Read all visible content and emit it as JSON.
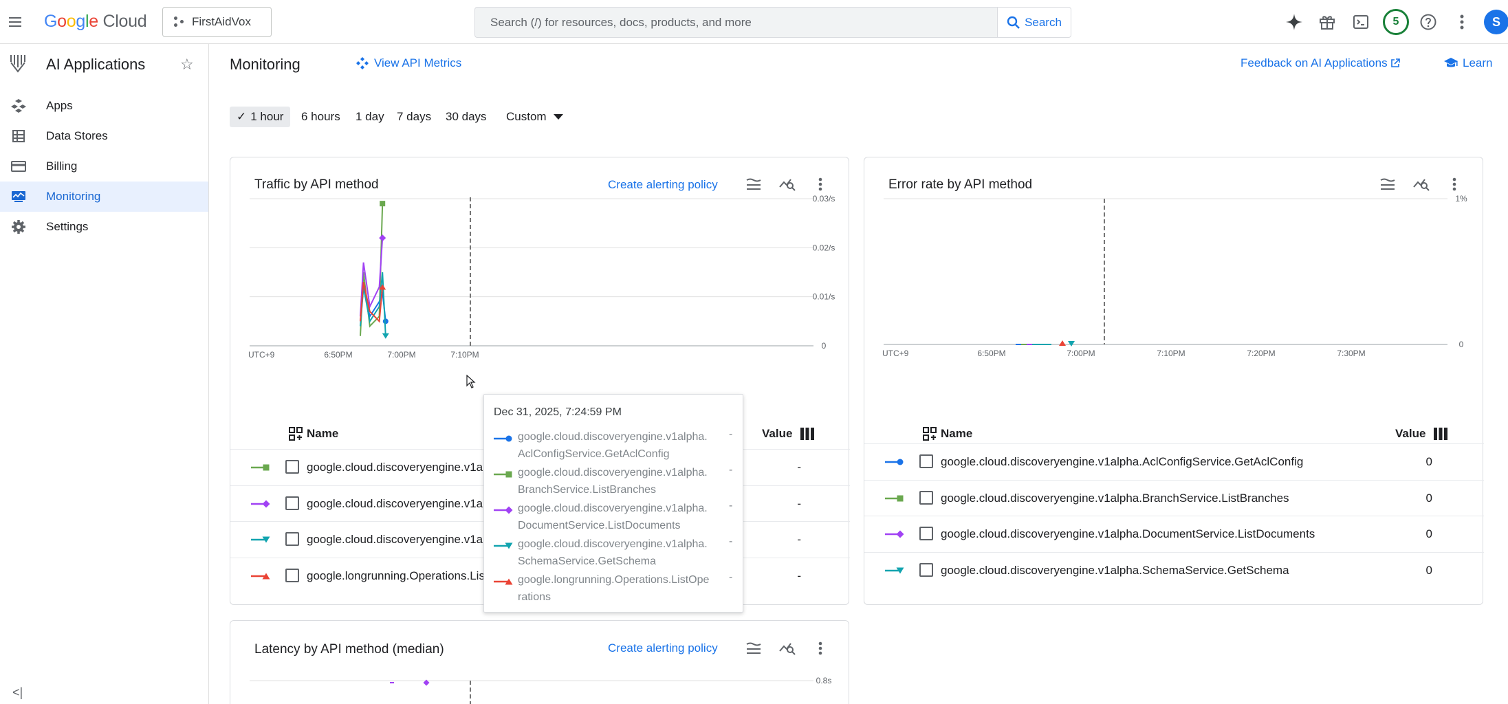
{
  "header": {
    "logo_google": "Google",
    "logo_cloud": "Cloud",
    "project_name": "FirstAidVox",
    "search_placeholder": "Search (/) for resources, docs, products, and more",
    "search_button": "Search",
    "notification_count": "5",
    "avatar_initial": "S"
  },
  "sidebar": {
    "product_title": "AI Applications",
    "items": [
      {
        "label": "Apps",
        "icon": "apps-icon"
      },
      {
        "label": "Data Stores",
        "icon": "data-stores-icon"
      },
      {
        "label": "Billing",
        "icon": "billing-icon"
      },
      {
        "label": "Monitoring",
        "icon": "monitoring-icon",
        "active": true
      },
      {
        "label": "Settings",
        "icon": "settings-icon"
      }
    ],
    "collapse_label": "<|"
  },
  "page": {
    "title": "Monitoring",
    "view_api_metrics": "View API Metrics",
    "feedback_link": "Feedback on AI Applications",
    "learn_link": "Learn"
  },
  "time_ranges": [
    {
      "label": "1 hour",
      "active": true
    },
    {
      "label": "6 hours"
    },
    {
      "label": "1 day"
    },
    {
      "label": "7 days"
    },
    {
      "label": "30 days"
    },
    {
      "label": "Custom",
      "dropdown": true
    }
  ],
  "colors": {
    "blue": "#1a73e8",
    "green": "#6aa84f",
    "purple": "#a142f4",
    "teal": "#12a4af",
    "red": "#ea4335"
  },
  "traffic_card": {
    "title": "Traffic by API method",
    "create_alert": "Create alerting policy",
    "name_header": "Name",
    "value_header": "Value",
    "rows": [
      {
        "name": "google.cloud.discoveryengine.v1alpha.BranchService.ListBranches",
        "value": "-",
        "marker": "square",
        "color": "#6aa84f"
      },
      {
        "name": "google.cloud.discoveryengine.v1alpha.DocumentService.ListDocuments",
        "value": "-",
        "marker": "diamond",
        "color": "#a142f4"
      },
      {
        "name": "google.cloud.discoveryengine.v1alpha.SchemaService.GetSchema",
        "value": "-",
        "marker": "triangle-down",
        "color": "#12a4af"
      },
      {
        "name": "google.longrunning.Operations.ListOperations",
        "value": "-",
        "marker": "triangle-up",
        "color": "#ea4335"
      }
    ]
  },
  "error_card": {
    "title": "Error rate by API method",
    "name_header": "Name",
    "value_header": "Value",
    "rows": [
      {
        "name": "google.cloud.discoveryengine.v1alpha.AclConfigService.GetAclConfig",
        "value": "0",
        "marker": "circle",
        "color": "#1a73e8"
      },
      {
        "name": "google.cloud.discoveryengine.v1alpha.BranchService.ListBranches",
        "value": "0",
        "marker": "square",
        "color": "#6aa84f"
      },
      {
        "name": "google.cloud.discoveryengine.v1alpha.DocumentService.ListDocuments",
        "value": "0",
        "marker": "diamond",
        "color": "#a142f4"
      },
      {
        "name": "google.cloud.discoveryengine.v1alpha.SchemaService.GetSchema",
        "value": "0",
        "marker": "triangle-down",
        "color": "#12a4af"
      }
    ]
  },
  "latency_card": {
    "title": "Latency by API method (median)",
    "create_alert": "Create alerting policy"
  },
  "tooltip": {
    "time": "Dec 31, 2025, 7:24:59 PM",
    "rows": [
      {
        "line1": "google.cloud.discoveryengine.v1alpha.",
        "line2": "AclConfigService.GetAclConfig",
        "value": "-",
        "marker": "circle",
        "color": "#1a73e8"
      },
      {
        "line1": "google.cloud.discoveryengine.v1alpha.",
        "line2": "BranchService.ListBranches",
        "value": "-",
        "marker": "square",
        "color": "#6aa84f"
      },
      {
        "line1": "google.cloud.discoveryengine.v1alpha.",
        "line2": "DocumentService.ListDocuments",
        "value": "-",
        "marker": "diamond",
        "color": "#a142f4"
      },
      {
        "line1": "google.cloud.discoveryengine.v1alpha.",
        "line2": "SchemaService.GetSchema",
        "value": "-",
        "marker": "triangle-down",
        "color": "#12a4af"
      },
      {
        "line1": "google.longrunning.Operations.ListOpe",
        "line2": "rations",
        "value": "-",
        "marker": "triangle-up",
        "color": "#ea4335"
      }
    ]
  },
  "chart_data": [
    {
      "type": "line",
      "title": "Traffic by API method",
      "timezone_label": "UTC+9",
      "x_ticks": [
        "6:50PM",
        "7:00PM",
        "7:10PM"
      ],
      "y_ticks": [
        "0",
        "0.01/s",
        "0.02/s",
        "0.03/s"
      ],
      "ylim": [
        0,
        0.03
      ],
      "hover_time": "7:24:59 PM",
      "series": [
        {
          "name": "google.cloud.discoveryengine.v1alpha.AclConfigService.GetAclConfig",
          "color": "#1a73e8",
          "marker": "circle",
          "points": [
            [
              "6:55",
              0.005
            ],
            [
              "6:55:30",
              0.012
            ],
            [
              "6:56:30",
              0.006
            ],
            [
              "6:58",
              0.009
            ],
            [
              "6:58:30",
              0.011
            ],
            [
              "6:59",
              0.005
            ]
          ]
        },
        {
          "name": "google.cloud.discoveryengine.v1alpha.BranchService.ListBranches",
          "color": "#6aa84f",
          "marker": "square",
          "points": [
            [
              "6:55",
              0.002
            ],
            [
              "6:55:30",
              0.015
            ],
            [
              "6:56:30",
              0.004
            ],
            [
              "6:58",
              0.006
            ],
            [
              "6:58:30",
              0.029
            ]
          ]
        },
        {
          "name": "google.cloud.discoveryengine.v1alpha.DocumentService.ListDocuments",
          "color": "#a142f4",
          "marker": "diamond",
          "points": [
            [
              "6:55",
              0.006
            ],
            [
              "6:55:30",
              0.017
            ],
            [
              "6:56:30",
              0.008
            ],
            [
              "6:58",
              0.012
            ],
            [
              "6:58:30",
              0.022
            ]
          ]
        },
        {
          "name": "google.cloud.discoveryengine.v1alpha.SchemaService.GetSchema",
          "color": "#12a4af",
          "marker": "triangle-down",
          "points": [
            [
              "6:55",
              0.004
            ],
            [
              "6:55:30",
              0.012
            ],
            [
              "6:56:30",
              0.005
            ],
            [
              "6:58",
              0.008
            ],
            [
              "6:58:30",
              0.015
            ],
            [
              "6:59",
              0.002
            ]
          ]
        },
        {
          "name": "google.longrunning.Operations.ListOperations",
          "color": "#ea4335",
          "marker": "triangle-up",
          "points": [
            [
              "6:55",
              0.005
            ],
            [
              "6:55:30",
              0.013
            ],
            [
              "6:56:30",
              0.007
            ],
            [
              "6:58",
              0.005
            ],
            [
              "6:58:30",
              0.012
            ]
          ]
        }
      ]
    },
    {
      "type": "line",
      "title": "Error rate by API method",
      "timezone_label": "UTC+9",
      "x_ticks": [
        "6:50PM",
        "7:00PM",
        "7:10PM",
        "7:20PM",
        "7:30PM"
      ],
      "y_ticks": [
        "0",
        "1%"
      ],
      "ylim": [
        0,
        1
      ],
      "series": [
        {
          "name": "google.cloud.discoveryengine.v1alpha.AclConfigService.GetAclConfig",
          "color": "#1a73e8",
          "values": [
            0
          ]
        },
        {
          "name": "google.cloud.discoveryengine.v1alpha.BranchService.ListBranches",
          "color": "#6aa84f",
          "values": [
            0
          ]
        },
        {
          "name": "google.cloud.discoveryengine.v1alpha.DocumentService.ListDocuments",
          "color": "#a142f4",
          "values": [
            0
          ]
        },
        {
          "name": "google.cloud.discoveryengine.v1alpha.SchemaService.GetSchema",
          "color": "#12a4af",
          "values": [
            0
          ]
        }
      ]
    },
    {
      "type": "line",
      "title": "Latency by API method (median)",
      "y_ticks": [
        "0.8s"
      ]
    }
  ]
}
